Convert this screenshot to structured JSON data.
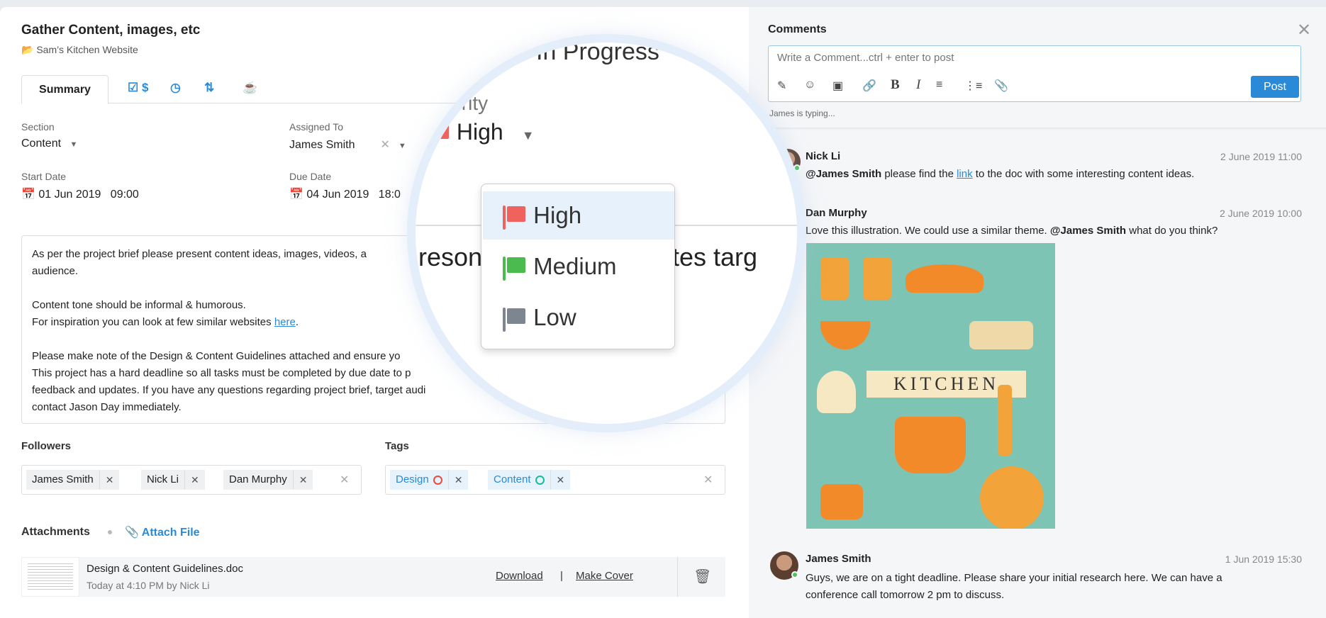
{
  "task": {
    "title": "Gather Content, images, etc",
    "project": "Sam’s Kitchen Website"
  },
  "tabs": {
    "summary": "Summary",
    "icons": [
      "checklist-icon",
      "dollar-icon",
      "clock-icon",
      "repeat-icon",
      "coffee-icon"
    ]
  },
  "fields": {
    "section_label": "Section",
    "section_value": "Content",
    "assigned_label": "Assigned To",
    "assigned_value": "James Smith",
    "start_label": "Start Date",
    "start_value": "01 Jun 2019   09:00",
    "due_label": "Due Date",
    "due_value": "04 Jun 2019   18:0"
  },
  "description": {
    "lines": [
      "As per the project brief please present content ideas, images, videos, a",
      "audience.",
      "",
      "Content tone should  be informal & humorous.",
      "For inspiration you can look at few similar websites ",
      "",
      "Please make note of the Design & Content Guidelines attached and ensure yo",
      "This project has a hard deadline so all tasks must be completed by due date to p",
      "feedback and updates. If you have any questions regarding project brief, target audi",
      "contact Jason Day immediately."
    ],
    "link_text": "here",
    "link_after": "."
  },
  "followers": {
    "label": "Followers",
    "items": [
      "James Smith",
      "Nick Li",
      "Dan Murphy"
    ]
  },
  "tags": {
    "label": "Tags",
    "items": [
      {
        "name": "Design",
        "color": "#e74c3c"
      },
      {
        "name": "Content",
        "color": "#1abc9c"
      }
    ]
  },
  "attachments": {
    "label": "Attachments",
    "attach_label": "Attach File",
    "file_name": "Design & Content Guidelines.doc",
    "file_meta": "Today at 4:10 PM by Nick Li",
    "download": "Download",
    "separator": "|",
    "make_cover": "Make Cover"
  },
  "magnifier": {
    "status": "In Progress",
    "priority_label": "Priority",
    "priority_value": "High",
    "options": [
      {
        "label": "High",
        "color": "#f0625e"
      },
      {
        "label": "Medium",
        "color": "#4cbb4f"
      },
      {
        "label": "Low",
        "color": "#7d8690"
      }
    ],
    "bg_text_left": "resona",
    "bg_text_right": "tes targ"
  },
  "comments": {
    "title": "Comments",
    "placeholder": "Write a Comment...ctrl + enter to post",
    "post": "Post",
    "typing_name": "James",
    "typing_suffix": " is typing...",
    "items": [
      {
        "name": "Nick Li",
        "time": "2 June 2019 11:00",
        "mention": "@James Smith",
        "text1": " please find the ",
        "link": "link",
        "text2": " to the doc with some interesting content ideas."
      },
      {
        "name": "Dan Murphy",
        "time": "2 June 2019 10:00",
        "text1": "Love this illustration. We could use a similar theme. ",
        "mention": "@James Smith",
        "text2": " what do you think?",
        "image_text": "KITCHEN"
      },
      {
        "name": "James Smith",
        "time": "1 Jun 2019 15:30",
        "text1": "Guys, we are on a tight deadline. Please share your initial research here. We can have a",
        "text2": "conference call tomorrow 2 pm to discuss."
      }
    ]
  },
  "colors": {
    "accent": "#2b8ad8",
    "online": "#4cc35a",
    "illustration_bg": "#7ec4b4"
  }
}
